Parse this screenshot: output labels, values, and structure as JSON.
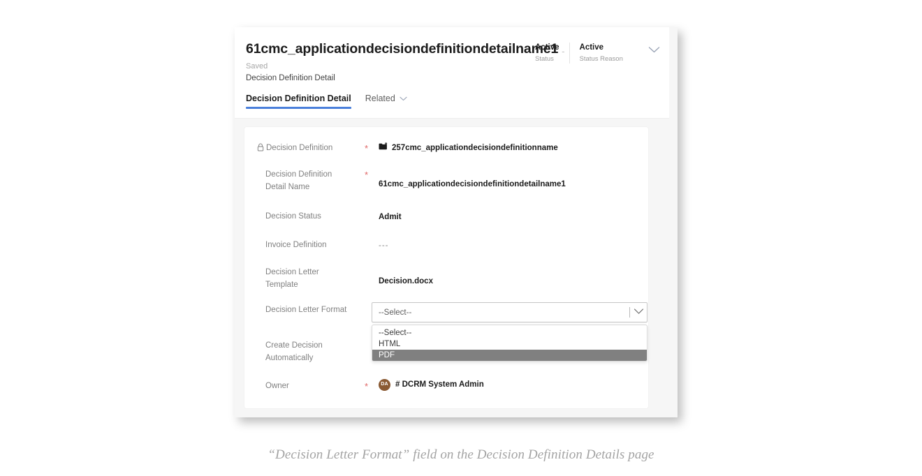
{
  "header": {
    "record_title": "61cmc_applicationdecisiondefinitiondetailname1",
    "title_trailing_dash": "-",
    "saved_text": "Saved",
    "entity_name": "Decision Definition Detail",
    "status": [
      {
        "value": "Active",
        "label": "Status"
      },
      {
        "value": "Active",
        "label": "Status Reason"
      }
    ],
    "chevron_icon": "chevron-down-icon"
  },
  "tabs": [
    {
      "label": "Decision Definition Detail",
      "active": true,
      "has_chevron": false
    },
    {
      "label": "Related",
      "active": false,
      "has_chevron": true
    }
  ],
  "form": {
    "fields": [
      {
        "label": "Decision Definition",
        "required": true,
        "locked": true,
        "value": "257cmc_applicationdecisiondefinitionname",
        "icon": "entity-record-icon"
      },
      {
        "label": "Decision Definition Detail Name",
        "required": true,
        "locked": false,
        "value": "61cmc_applicationdecisiondefinitiondetailname1"
      },
      {
        "label": "Decision Status",
        "required": false,
        "locked": false,
        "value": "Admit"
      },
      {
        "label": "Invoice Definition",
        "required": false,
        "locked": false,
        "value": "---"
      },
      {
        "label": "Decision Letter Template",
        "required": false,
        "locked": false,
        "value": "Decision.docx"
      },
      {
        "label": "Decision Letter Format",
        "required": false,
        "locked": false,
        "value": ""
      },
      {
        "label": "Create Decision Automatically",
        "required": false,
        "locked": false,
        "value": ""
      }
    ],
    "owner": {
      "label": "Owner",
      "required": true,
      "avatar_initials": "DA",
      "avatar_color": "#8a5a33",
      "name": "# DCRM System Admin"
    }
  },
  "combobox": {
    "name": "decision-letter-format",
    "selected_text": "--Select--",
    "expanded": true,
    "options": [
      {
        "label": "--Select--",
        "selected": false
      },
      {
        "label": "HTML",
        "selected": false
      },
      {
        "label": "PDF",
        "selected": true
      }
    ],
    "highlight_color": "#808080"
  },
  "caption": {
    "text": "“Decision Letter Format” field on the Decision Definition Details page"
  },
  "colors": {
    "accent_tab_underline": "#4a7fdb",
    "required_star": "#e06666",
    "page_background": "#f6f6f6"
  }
}
